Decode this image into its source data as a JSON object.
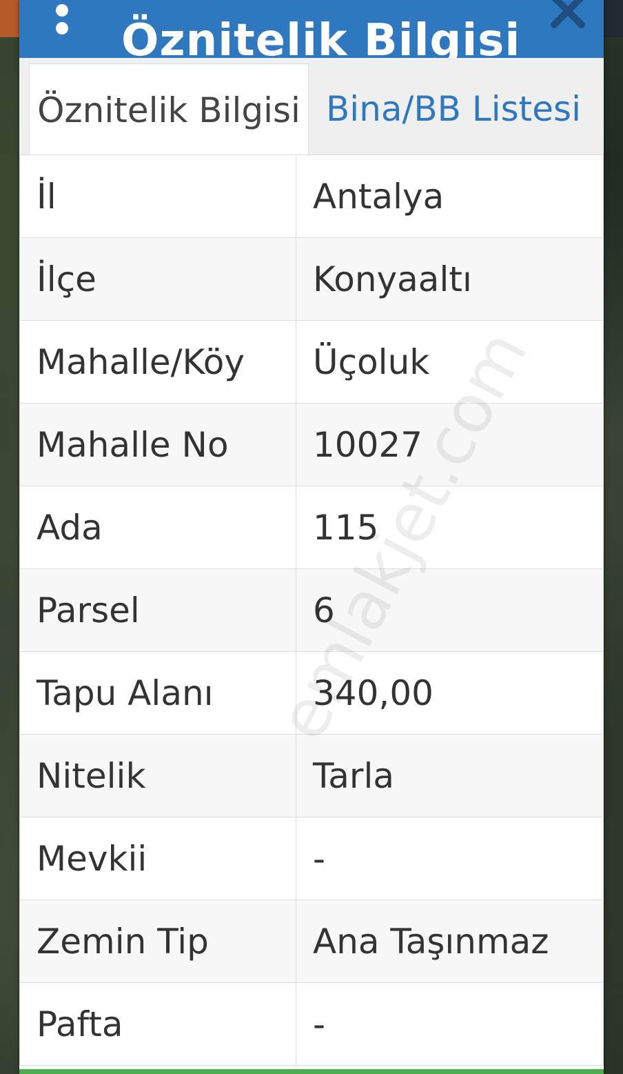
{
  "header": {
    "title": "Öznitelik Bilgisi"
  },
  "tabs": [
    {
      "label": "Öznitelik Bilgisi",
      "active": true
    },
    {
      "label": "Bina/BB Listesi",
      "active": false
    }
  ],
  "attributes": [
    {
      "key": "İl",
      "value": "Antalya"
    },
    {
      "key": "İlçe",
      "value": "Konyaaltı"
    },
    {
      "key": "Mahalle/Köy",
      "value": "Üçoluk"
    },
    {
      "key": "Mahalle No",
      "value": "10027"
    },
    {
      "key": "Ada",
      "value": "115"
    },
    {
      "key": "Parsel",
      "value": "6"
    },
    {
      "key": "Tapu Alanı",
      "value": "340,00"
    },
    {
      "key": "Nitelik",
      "value": "Tarla"
    },
    {
      "key": "Mevkii",
      "value": "-"
    },
    {
      "key": "Zemin Tip",
      "value": "Ana Taşınmaz"
    },
    {
      "key": "Pafta",
      "value": "-"
    }
  ],
  "watermark": "emlakjet.com",
  "colors": {
    "header": "#2f78c0",
    "tab_link": "#2f78c0",
    "footer": "#4cae4c"
  },
  "icons": {
    "menu": "vertical-dots-icon",
    "close": "close-icon"
  }
}
